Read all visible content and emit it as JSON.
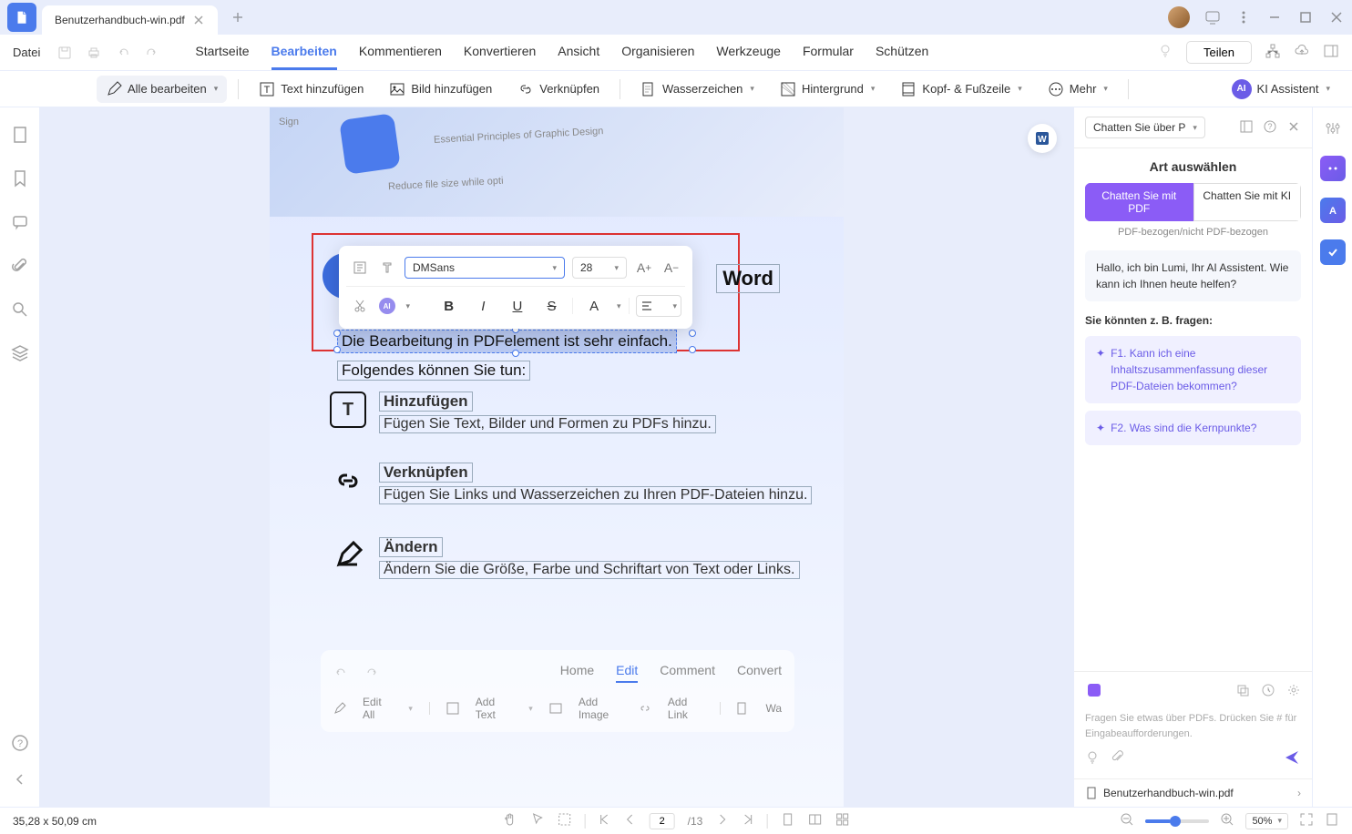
{
  "titlebar": {
    "tab_name": "Benutzerhandbuch-win.pdf"
  },
  "menubar": {
    "file": "Datei",
    "tabs": [
      "Startseite",
      "Bearbeiten",
      "Kommentieren",
      "Konvertieren",
      "Ansicht",
      "Organisieren",
      "Werkzeuge",
      "Formular",
      "Schützen"
    ],
    "share": "Teilen"
  },
  "ribbon": {
    "edit_all": "Alle bearbeiten",
    "add_text": "Text hinzufügen",
    "add_image": "Bild hinzufügen",
    "link": "Verknüpfen",
    "watermark": "Wasserzeichen",
    "background": "Hintergrund",
    "header_footer": "Kopf- & Fußzeile",
    "more": "Mehr",
    "ai_assistant": "KI Assistent"
  },
  "editing_toolbar": {
    "font": "DMSans",
    "size": "28"
  },
  "document": {
    "faded1": "Essential Principles of Graphic Design",
    "faded2": "Reduce file size while opti",
    "faded3": "Sign",
    "word_label": "Word",
    "selected_text": "Die Bearbeitung in PDFelement ist sehr einfach.",
    "intro": "Folgendes können Sie tun:",
    "sections": [
      {
        "title": "Hinzufügen",
        "desc": "Fügen Sie Text, Bilder und Formen zu PDFs hinzu."
      },
      {
        "title": "Verknüpfen",
        "desc": "Fügen Sie Links und Wasserzeichen zu Ihren PDF-Dateien hinzu."
      },
      {
        "title": "Ändern",
        "desc": "Ändern Sie die Größe, Farbe und Schriftart von Text oder Links."
      }
    ],
    "mock_tabs": {
      "home": "Home",
      "edit": "Edit",
      "comment": "Comment",
      "convert": "Convert"
    },
    "mock_ribbon": {
      "edit_all": "Edit All",
      "add_text": "Add Text",
      "add_image": "Add Image",
      "add_link": "Add Link",
      "wa": "Wa"
    }
  },
  "ai_panel": {
    "dropdown": "Chatten Sie über P",
    "title": "Art auswählen",
    "tab_pdf": "Chatten Sie mit PDF",
    "tab_ai": "Chatten Sie mit KI",
    "subtext": "PDF-bezogen/nicht PDF-bezogen",
    "greeting": "Hallo, ich bin Lumi, Ihr AI Assistent. Wie kann ich Ihnen heute helfen?",
    "suggest_title": "Sie könnten z. B. fragen:",
    "suggest1": "F1. Kann ich eine Inhaltszusammenfassung dieser PDF-Dateien bekommen?",
    "suggest2": "F2. Was sind die Kernpunkte?",
    "input_placeholder": "Fragen Sie etwas über PDFs. Drücken Sie # für Eingabeaufforderungen.",
    "filename": "Benutzerhandbuch-win.pdf"
  },
  "statusbar": {
    "coords": "35,28 x 50,09 cm",
    "page_current": "2",
    "page_total": "/13",
    "zoom": "50%"
  }
}
